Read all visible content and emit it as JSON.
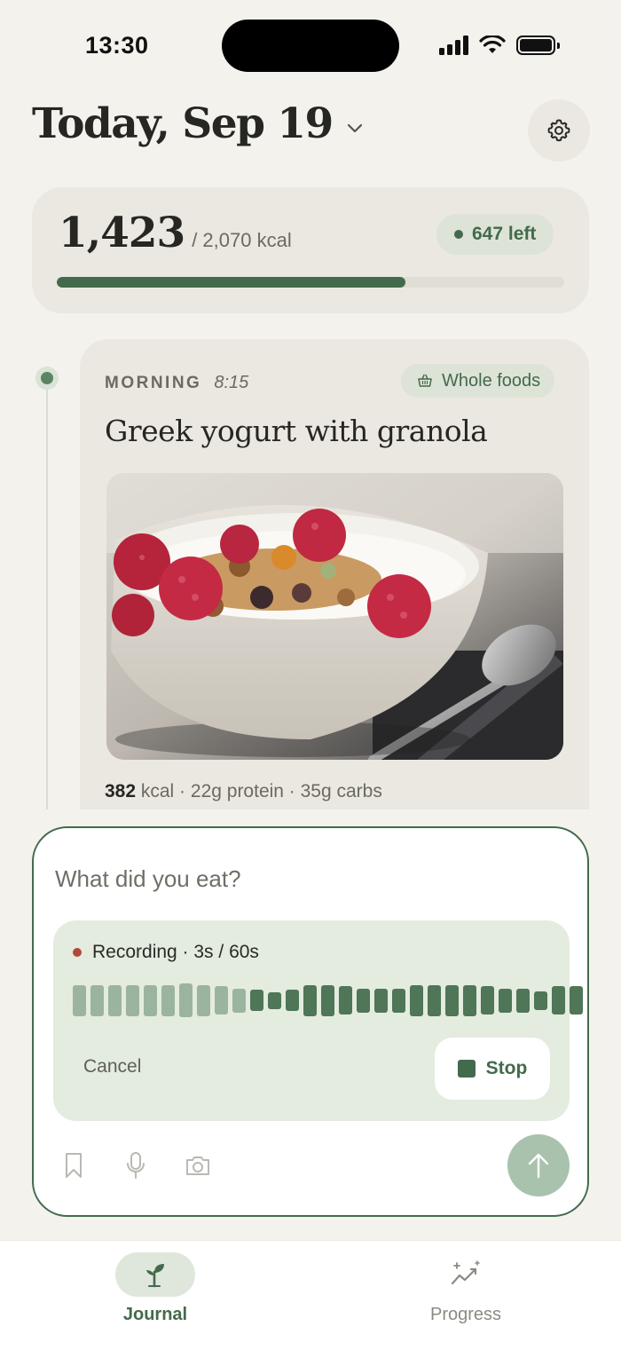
{
  "status_bar": {
    "time": "13:30"
  },
  "header": {
    "title": "Today, Sep 19"
  },
  "summary": {
    "consumed": "1,423",
    "goal": "/ 2,070 kcal",
    "remaining": "647 left",
    "progress_fraction": 0.687
  },
  "meal": {
    "period": "MORNING",
    "time": "8:15",
    "tag": "Whole foods",
    "title": "Greek yogurt with granola",
    "kcal": "382",
    "stats_rest": " kcal · 22g protein · 35g carbs"
  },
  "composer": {
    "placeholder": "What did you eat?",
    "recording_status": "Recording · 3s / 60s",
    "cancel_label": "Cancel",
    "stop_label": "Stop",
    "waveform_levels": [
      0.92,
      0.92,
      0.92,
      0.92,
      0.92,
      0.92,
      1.0,
      0.92,
      0.85,
      0.7,
      0.62,
      0.5,
      0.62,
      0.92,
      0.92,
      0.85,
      0.7,
      0.7,
      0.7,
      0.92,
      0.92,
      0.92,
      0.92,
      0.85,
      0.7,
      0.7,
      0.55,
      0.85,
      0.85
    ],
    "waveform_played_count": 10
  },
  "tabs": [
    {
      "label": "Journal",
      "active": true
    },
    {
      "label": "Progress",
      "active": false
    }
  ],
  "colors": {
    "accent": "#436a4c",
    "accent_soft": "#dde3d7",
    "background": "#f4f2ed",
    "card": "#ebe8e1",
    "recording_dot": "#b04a3b"
  },
  "icons": {
    "header_chevron": "chevron-down-icon",
    "settings": "gear-icon",
    "tag": "basket-icon",
    "tools": [
      "bookmark-icon",
      "microphone-icon",
      "camera-icon"
    ],
    "send": "arrow-up-icon",
    "journal_tab": "sprout-icon",
    "progress_tab": "sparkle-trend-icon"
  }
}
